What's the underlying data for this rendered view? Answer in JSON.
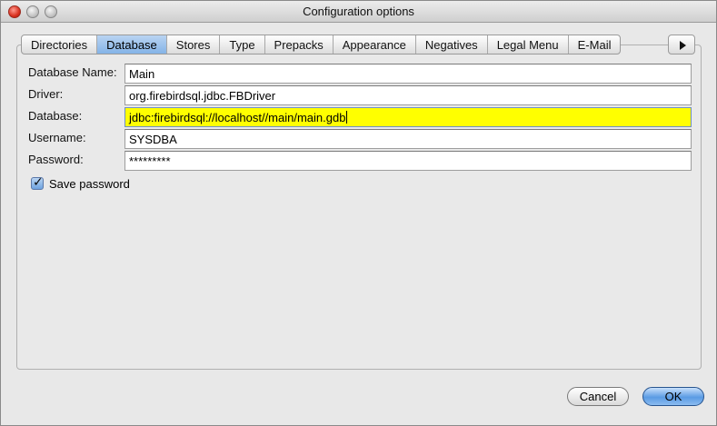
{
  "window": {
    "title": "Configuration options"
  },
  "tabs": [
    {
      "label": "Directories",
      "active": false
    },
    {
      "label": "Database",
      "active": true
    },
    {
      "label": "Stores",
      "active": false
    },
    {
      "label": "Type",
      "active": false
    },
    {
      "label": "Prepacks",
      "active": false
    },
    {
      "label": "Appearance",
      "active": false
    },
    {
      "label": "Negatives",
      "active": false
    },
    {
      "label": "Legal Menu",
      "active": false
    },
    {
      "label": "E-Mail",
      "active": false
    }
  ],
  "form": {
    "database_name": {
      "label": "Database Name:",
      "value": "Main"
    },
    "driver": {
      "label": "Driver:",
      "value": "org.firebirdsql.jdbc.FBDriver"
    },
    "database": {
      "label": "Database:",
      "value": "jdbc:firebirdsql://localhost//main/main.gdb"
    },
    "username": {
      "label": "Username:",
      "value": "SYSDBA"
    },
    "password": {
      "label": "Password:",
      "value": "*********"
    },
    "save_password": {
      "label": "Save password",
      "checked": true
    }
  },
  "buttons": {
    "cancel": "Cancel",
    "ok": "OK"
  },
  "colors": {
    "highlight": "#ffff00",
    "active_tab": "#7fb0e6",
    "default_button": "#5a9be4"
  }
}
